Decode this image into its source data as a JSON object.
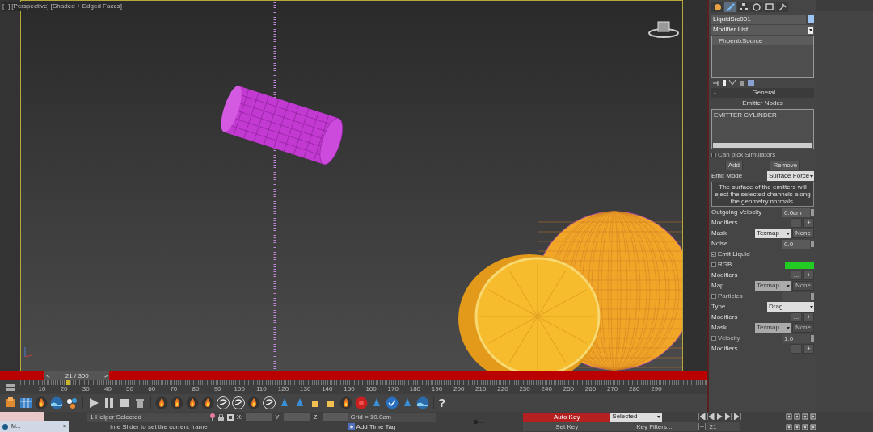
{
  "viewport": {
    "label": "[+] [Perspective] [Shaded + Edged Faces]",
    "active": true
  },
  "command_panel": {
    "tabs": [
      {
        "kind": "create",
        "selected": false
      },
      {
        "kind": "modify",
        "selected": true
      },
      {
        "kind": "hierarchy",
        "selected": false
      },
      {
        "kind": "motion",
        "selected": false
      },
      {
        "kind": "display",
        "selected": false
      },
      {
        "kind": "utilities",
        "selected": false
      }
    ],
    "object_name": "LiquidSrc001",
    "modifier_list": "Modifier List",
    "stack": [
      {
        "label": "PhoenixSource",
        "selected": true
      }
    ],
    "rollout": {
      "toggle": "-",
      "title": "General",
      "rows": [
        {
          "kind": "heading",
          "label": "Emitter Nodes"
        },
        {
          "kind": "listbox",
          "items": [
            "EMITTER CYLINDER"
          ]
        },
        {
          "kind": "checkbox",
          "label": "Can pick Simulators",
          "checked": false
        },
        {
          "kind": "buttons",
          "buttons": [
            "Add",
            "Remove"
          ]
        },
        {
          "kind": "dropdown",
          "label": "Emit Mode",
          "value": "Surface Force",
          "disabled": false
        },
        {
          "kind": "note",
          "text": "The surface of the emitters will eject the selected channels along the geometry normals."
        },
        {
          "kind": "spinner",
          "label": "Outgoing Velocity",
          "value": "0.0cm"
        },
        {
          "kind": "modifiers",
          "label": "Modifiers",
          "more": "...",
          "add": "+"
        },
        {
          "kind": "dropdown",
          "label": "Mask",
          "value": "Texmap",
          "button": "None",
          "disabled": false
        },
        {
          "kind": "spinner",
          "label": "Noise",
          "value": "0.0"
        },
        {
          "kind": "checkbox",
          "label": "Emit Liquid",
          "checked": true
        },
        {
          "kind": "checkbox",
          "label": "RGB",
          "checked": false,
          "color": "#22cc22"
        },
        {
          "kind": "modifiers",
          "label": "Modifiers",
          "more": "...",
          "add": "+"
        },
        {
          "kind": "dropdown",
          "label": "Map",
          "value": "Texmap",
          "button": "None",
          "disabled": true
        },
        {
          "kind": "checkbox",
          "label": "Particles",
          "checked": false,
          "spinner": true
        },
        {
          "kind": "dropdown",
          "label": "Type",
          "value": "Drag",
          "disabled": false
        },
        {
          "kind": "modifiers",
          "label": "Modifiers",
          "more": "...",
          "add": "+"
        },
        {
          "kind": "dropdown",
          "label": "Mask",
          "value": "Texmap",
          "button": "None",
          "disabled": true
        },
        {
          "kind": "checkbox",
          "label": "Velocity",
          "checked": false,
          "value": "1.0"
        },
        {
          "kind": "modifiers",
          "label": "Modifiers",
          "more": "...",
          "add": "+"
        }
      ]
    }
  },
  "time_slider": {
    "prev": "<",
    "label": "21 / 300",
    "next": ">",
    "level": 0.07
  },
  "ruler_labels": [
    "10",
    "20",
    "30",
    "40",
    "50",
    "60",
    "70",
    "80",
    "90",
    "100",
    "110",
    "120",
    "130",
    "140",
    "150",
    "160",
    "170",
    "180",
    "190",
    "200",
    "210",
    "220",
    "230",
    "240",
    "250",
    "260",
    "270",
    "280",
    "290"
  ],
  "help_button": "?",
  "status": {
    "selection": "1 Helper Selected",
    "prompt": "ime Slider to set the current frame",
    "coords": [
      {
        "label": "X:"
      },
      {
        "label": "Y:"
      },
      {
        "label": "Z:"
      }
    ],
    "grid": "Grid = 10.0cm",
    "time_tag": "Add Time Tag",
    "auto_key": {
      "label": "Auto Key",
      "on": true
    },
    "key_mode": "Selected",
    "set_key": "Set Key",
    "key_filters": "Key Filters...",
    "frame": "21"
  },
  "taskbar_preview": {
    "title": "M...",
    "close": "×"
  }
}
